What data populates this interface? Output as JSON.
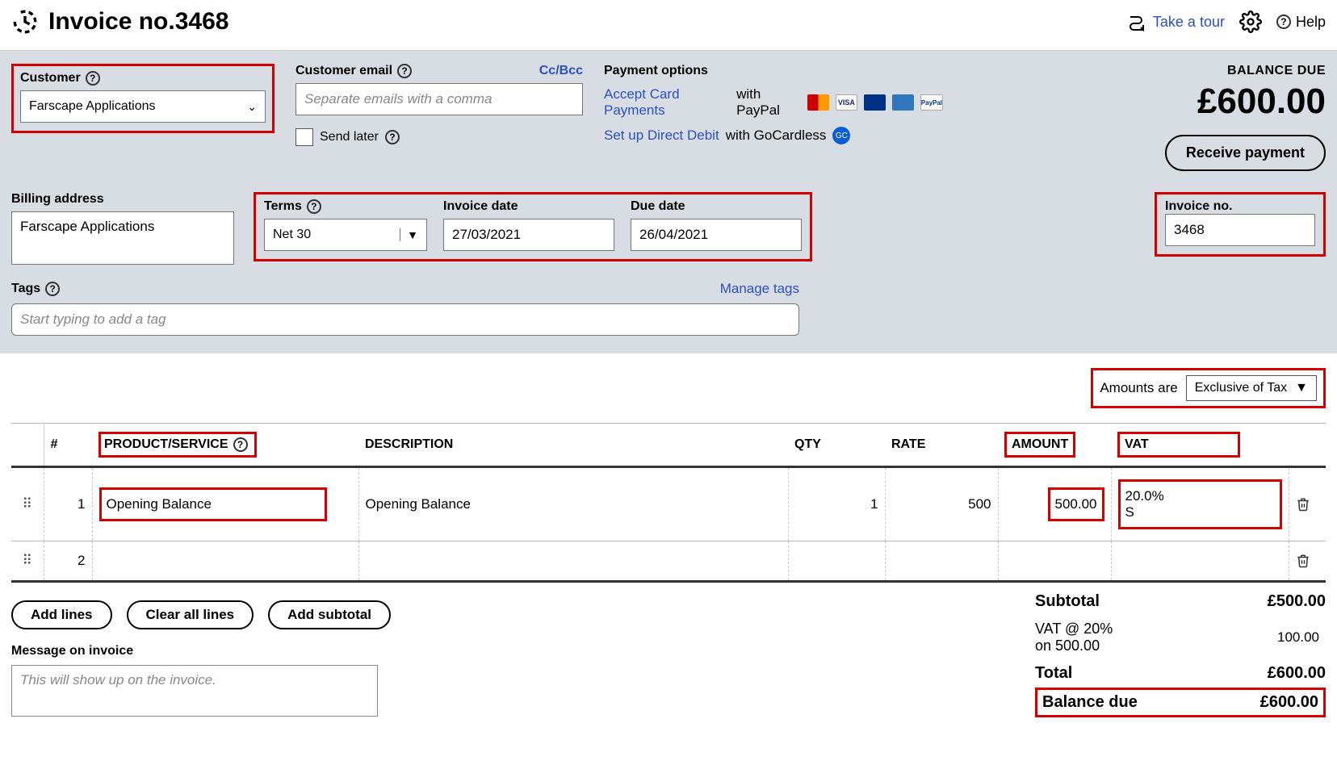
{
  "header": {
    "title": "Invoice no.3468",
    "take_tour": "Take a tour",
    "help": "Help"
  },
  "customer": {
    "label": "Customer",
    "value": "Farscape Applications"
  },
  "customer_email": {
    "label": "Customer email",
    "placeholder": "Separate emails with a comma",
    "ccbcc": "Cc/Bcc",
    "send_later": "Send later"
  },
  "payment": {
    "title": "Payment options",
    "accept_link": "Accept Card Payments",
    "accept_suffix": " with PayPal",
    "direct_link": "Set up Direct Debit",
    "direct_suffix": " with GoCardless"
  },
  "balance": {
    "label": "BALANCE DUE",
    "amount": "£600.00",
    "receive": "Receive payment"
  },
  "billing": {
    "label": "Billing address",
    "value": "Farscape Applications"
  },
  "terms": {
    "label": "Terms",
    "value": "Net 30"
  },
  "invoice_date": {
    "label": "Invoice date",
    "value": "27/03/2021"
  },
  "due_date": {
    "label": "Due date",
    "value": "26/04/2021"
  },
  "invoice_no": {
    "label": "Invoice no.",
    "value": "3468"
  },
  "tags": {
    "label": "Tags",
    "placeholder": "Start typing to add a tag",
    "manage": "Manage tags"
  },
  "amounts_are": {
    "label": "Amounts are",
    "value": "Exclusive of Tax"
  },
  "table": {
    "headers": {
      "num": "#",
      "product": "PRODUCT/SERVICE",
      "desc": "DESCRIPTION",
      "qty": "QTY",
      "rate": "RATE",
      "amount": "AMOUNT",
      "vat": "VAT"
    },
    "rows": [
      {
        "n": "1",
        "product": "Opening Balance",
        "desc": "Opening Balance",
        "qty": "1",
        "rate": "500",
        "amount": "500.00",
        "vat": "20.0% S"
      },
      {
        "n": "2",
        "product": "",
        "desc": "",
        "qty": "",
        "rate": "",
        "amount": "",
        "vat": ""
      }
    ]
  },
  "buttons": {
    "add_lines": "Add lines",
    "clear_all": "Clear all lines",
    "add_subtotal": "Add subtotal"
  },
  "message": {
    "label": "Message on invoice",
    "placeholder": "This will show up on the invoice."
  },
  "totals": {
    "subtotal_label": "Subtotal",
    "subtotal_value": "£500.00",
    "vat_label": "VAT @ 20% on 500.00",
    "vat_value": "100.00",
    "total_label": "Total",
    "total_value": "£600.00",
    "baldue_label": "Balance due",
    "baldue_value": "£600.00"
  }
}
